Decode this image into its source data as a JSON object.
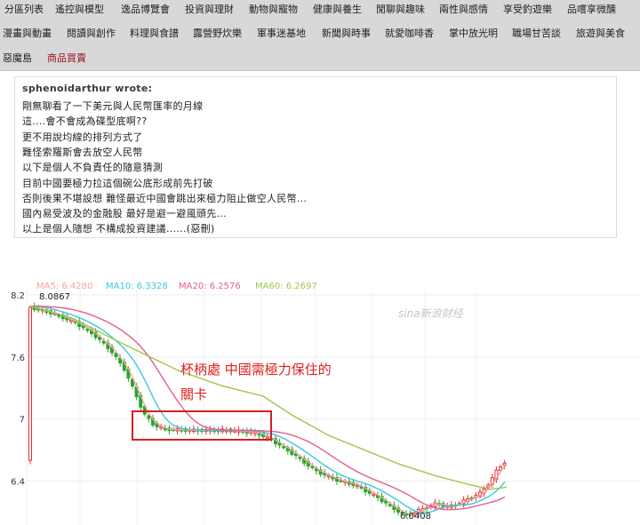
{
  "nav": {
    "items": [
      {
        "label": "分區列表"
      },
      {
        "label": "遙控與模型"
      },
      {
        "label": "逸品博覽會"
      },
      {
        "label": "投資與理財"
      },
      {
        "label": "動物與寵物"
      },
      {
        "label": "健康與養生"
      },
      {
        "label": "閒聊與趣味"
      },
      {
        "label": "兩性與感情"
      },
      {
        "label": "享受釣遊樂"
      },
      {
        "label": "品嚐享微醺"
      },
      {
        "label": "漫畫與動畫"
      },
      {
        "label": "閱讀與創作"
      },
      {
        "label": "料理與食譜"
      },
      {
        "label": "露營野炊樂"
      },
      {
        "label": "軍事迷基地"
      },
      {
        "label": "新聞與時事"
      },
      {
        "label": "就愛咖啡香"
      },
      {
        "label": "掌中放光明"
      },
      {
        "label": "職場甘苦談"
      },
      {
        "label": "旅遊與美食"
      },
      {
        "label": "惡魔島"
      },
      {
        "label": "商品買賣"
      }
    ],
    "active_label": "商品買賣"
  },
  "quote": {
    "author": "sphenoidarthur wrote:",
    "lines": [
      "剛無聊看了一下美元與人民幣匯率的月線",
      "這....會不會成為碟型底啊??",
      "更不用說均線的排列方式了",
      "難怪索羅斯會去放空人民幣",
      "以下是個人不負責任的隨意猜測",
      "目前中國要極力拉這個碗公底形成前先打破",
      "否則後果不堪設想 難怪最近中國會跳出來極力阻止做空人民幣...",
      "國內易受波及的金融股 最好是避一避風頭先...",
      "以上是個人隨想 不構成投資建議......(惡刪)"
    ]
  },
  "chart_data": {
    "type": "line",
    "series": [
      {
        "name": "MA5",
        "label": "MA5: 6.4280",
        "color": "#f4a3a3"
      },
      {
        "name": "MA10",
        "label": "MA10: 6.3328",
        "color": "#3ec6e0"
      },
      {
        "name": "MA20",
        "label": "MA20: 6.2576",
        "color": "#e65d8e"
      },
      {
        "name": "MA60",
        "label": "MA60: 6.2697",
        "color": "#9cc74a"
      }
    ],
    "y_ticks": [
      "8.2",
      "7.6",
      "7",
      "6.4"
    ],
    "y_range": [
      6.0,
      8.2
    ],
    "high_label": "8.0867",
    "low_label": "6.0408",
    "watermark": "sina新浪财经",
    "annotation_line1": "杯柄處 中國需極力保住的",
    "annotation_line2": "關卡",
    "annotation_color": "#e02020",
    "up_color": "#e8303a",
    "down_color": "#2aa52a"
  }
}
